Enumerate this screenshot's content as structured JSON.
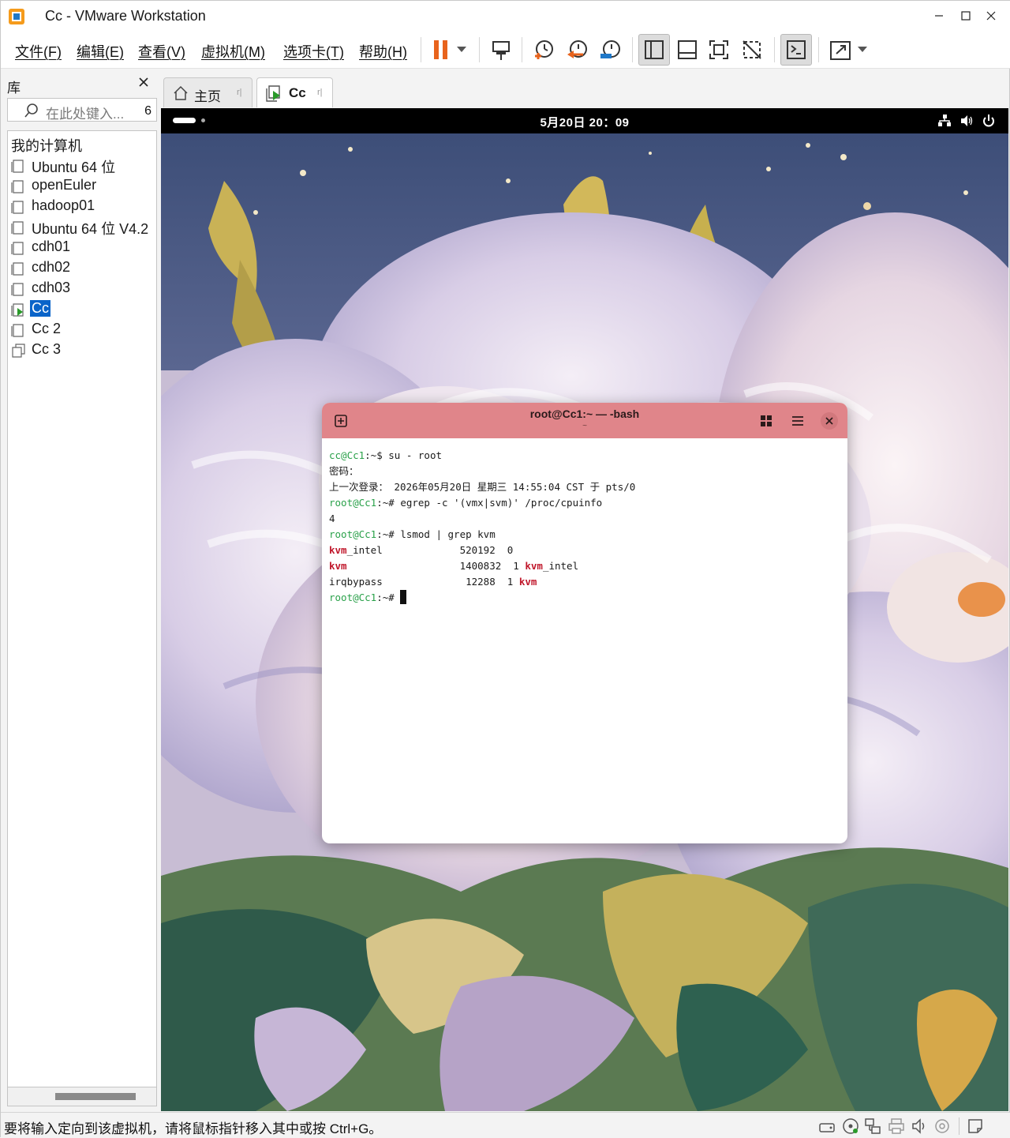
{
  "window": {
    "title": "Cc - VMware Workstation"
  },
  "menu": [
    "文件(F)",
    "编辑(E)",
    "查看(V)",
    "虚拟机(M)",
    "选项卡(T)",
    "帮助(H)"
  ],
  "toolbar": {
    "icons": [
      "pause-icon",
      "dropdown-icon",
      "send-ctrl-alt-del-icon",
      "snapshot-take-icon",
      "snapshot-revert-icon",
      "snapshot-manager-icon",
      "show-library-icon",
      "show-thumbnail-icon",
      "full-screen-icon",
      "unity-icon",
      "console-view-icon",
      "stretch-icon",
      "dropdown-icon"
    ],
    "pause_color": "#e8631c"
  },
  "library": {
    "title": "库",
    "search_placeholder": "在此处键入...",
    "search_count": "6",
    "root": "我的计算机",
    "items": [
      {
        "label": "Ubuntu 64 位",
        "state": "off"
      },
      {
        "label": "openEuler",
        "state": "off"
      },
      {
        "label": "hadoop01",
        "state": "off"
      },
      {
        "label": "Ubuntu 64 位 V4.2",
        "state": "off"
      },
      {
        "label": "cdh01",
        "state": "off"
      },
      {
        "label": "cdh02",
        "state": "off"
      },
      {
        "label": "cdh03",
        "state": "off"
      },
      {
        "label": "Cc",
        "state": "running"
      },
      {
        "label": "Cc 2",
        "state": "off"
      },
      {
        "label": "Cc 3",
        "state": "clone"
      }
    ],
    "selected": "Cc"
  },
  "tabs": [
    {
      "label": "主页",
      "icon": "home-icon",
      "active": false
    },
    {
      "label": "Cc",
      "icon": "vm-running-icon",
      "active": true
    }
  ],
  "guest": {
    "clock": "5月20日  20：09",
    "status_icons": [
      "network-icon",
      "volume-icon",
      "power-icon"
    ],
    "terminal": {
      "title": "root@Cc1:~ — -bash",
      "subtitle": "~",
      "lines": [
        {
          "prompt": "cc@Cc1",
          "path": ":~$ ",
          "cmd": "su - root"
        },
        {
          "text": "密码："
        },
        {
          "text": "上一次登录： 2026年05月20日 星期三 14:55:04 CST 于 pts/0"
        },
        {
          "prompt": "root@Cc1",
          "path": ":~# ",
          "cmd": "egrep -c '(vmx|svm)' /proc/cpuinfo"
        },
        {
          "text": "4"
        },
        {
          "prompt": "root@Cc1",
          "path": ":~# ",
          "cmd": "lsmod | grep kvm"
        },
        {
          "mod_hl": "kvm",
          "mod_rest": "_intel",
          "cols": "             520192  0",
          "used_hl": "",
          "used_rest": ""
        },
        {
          "mod_hl": "kvm",
          "mod_rest": "",
          "cols": "                   1400832  1 ",
          "used_hl": "kvm",
          "used_rest": "_intel"
        },
        {
          "mod_hl": "",
          "mod_rest": "irqbypass",
          "cols": "              12288  1 ",
          "used_hl": "kvm",
          "used_rest": ""
        },
        {
          "prompt": "root@Cc1",
          "path": ":~# ",
          "cmd": "",
          "cursor": true
        }
      ],
      "header_color": "#e0858a"
    }
  },
  "statusbar": {
    "text": "要将输入定向到该虚拟机，请将鼠标指针移入其中或按 Ctrl+G。",
    "icons": [
      "hdd-icon",
      "cdrom-icon",
      "network-adapter-icon",
      "printer-icon",
      "sound-icon",
      "usb-icon",
      "message-icon"
    ]
  }
}
